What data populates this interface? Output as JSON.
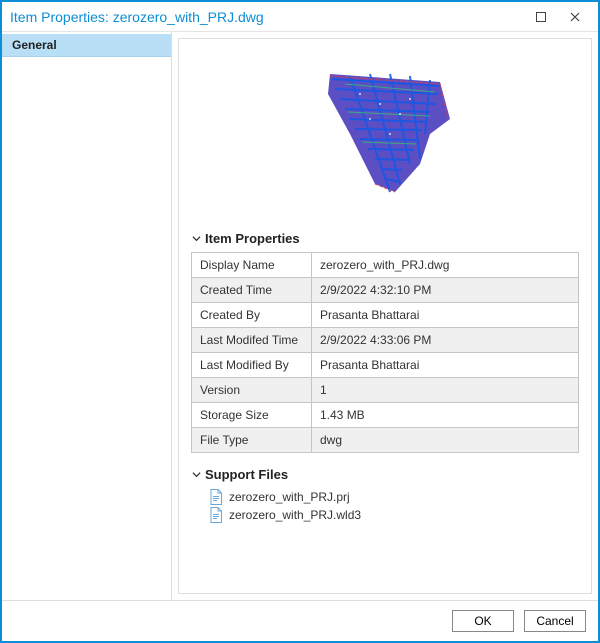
{
  "window": {
    "title": "Item Properties: zerozero_with_PRJ.dwg"
  },
  "sidebar": {
    "items": [
      {
        "label": "General",
        "active": true
      }
    ]
  },
  "sections": {
    "item_properties_label": "Item Properties",
    "support_files_label": "Support Files"
  },
  "properties": [
    {
      "key": "Display Name",
      "value": "zerozero_with_PRJ.dwg"
    },
    {
      "key": "Created Time",
      "value": "2/9/2022 4:32:10 PM"
    },
    {
      "key": "Created By",
      "value": "Prasanta Bhattarai"
    },
    {
      "key": "Last Modifed Time",
      "value": "2/9/2022 4:33:06 PM"
    },
    {
      "key": "Last Modified By",
      "value": "Prasanta Bhattarai"
    },
    {
      "key": "Version",
      "value": "1"
    },
    {
      "key": "Storage Size",
      "value": "1.43 MB"
    },
    {
      "key": "File Type",
      "value": "dwg"
    }
  ],
  "support_files": [
    {
      "name": "zerozero_with_PRJ.prj"
    },
    {
      "name": "zerozero_with_PRJ.wld3"
    }
  ],
  "footer": {
    "ok_label": "OK",
    "cancel_label": "Cancel"
  }
}
